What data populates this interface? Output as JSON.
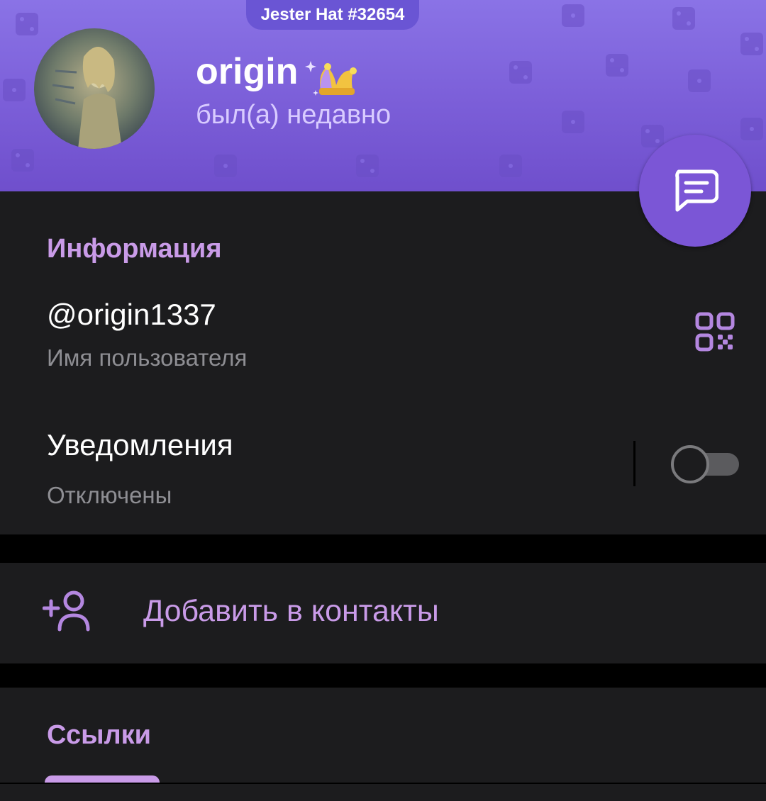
{
  "header": {
    "gift_tag": "Jester Hat #32654",
    "display_name": "origin",
    "status": "был(а) недавно",
    "emoji_status_icon": "jester-hat-icon",
    "accent_color": "#7b5ed8"
  },
  "fab": {
    "icon": "message-icon",
    "color": "#7b56d6"
  },
  "info": {
    "title": "Информация",
    "username": "@origin1337",
    "username_caption": "Имя пользователя",
    "qr_icon": "qr-code-icon",
    "notifications_label": "Уведомления",
    "notifications_value": "Отключены",
    "notifications_enabled": false
  },
  "actions": {
    "add_contact_label": "Добавить в контакты",
    "add_contact_icon": "add-user-icon"
  },
  "links": {
    "title": "Ссылки"
  },
  "colors": {
    "accent_text": "#c99be8",
    "card_bg": "#1c1c1e",
    "secondary_text": "#8e8e93"
  }
}
